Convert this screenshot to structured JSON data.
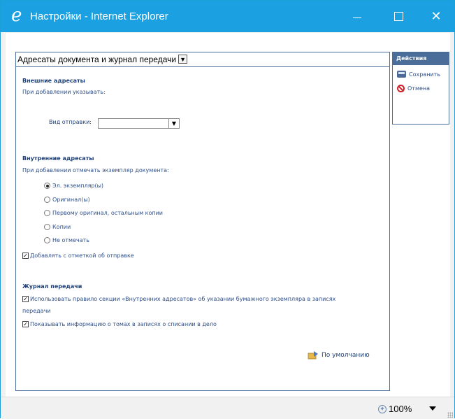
{
  "window": {
    "title": "Настройки - Internet Explorer",
    "accent": "#1ba1e2"
  },
  "panel": {
    "section_select": "Адресаты документа и журнал передачи",
    "external": {
      "heading": "Внешние адресаты",
      "hint": "При добавлении указывать:",
      "send_type_label": "Вид отправки:",
      "send_type_value": ""
    },
    "internal": {
      "heading": "Внутренние адресаты",
      "hint": "При добавлении отмечать экземпляр документа:",
      "options": [
        {
          "label": "Эл. экземпляр(ы)",
          "selected": true
        },
        {
          "label": "Оригинал(ы)",
          "selected": false
        },
        {
          "label": "Первому оригинал, остальным копии",
          "selected": false
        },
        {
          "label": "Копии",
          "selected": false
        },
        {
          "label": "Не отмечать",
          "selected": false
        }
      ],
      "add_with_mark": {
        "label": "Добавлять с отметкой об отправке",
        "checked": true
      }
    },
    "journal": {
      "heading": "Журнал передачи",
      "use_rule_line1": "Использовать правило секции «Внутренних адресатов» об указании бумажного экземпляра в записях",
      "use_rule_line2": "передачи",
      "use_rule_checked": true,
      "show_volumes": {
        "label": "Показывать информацию о томах в записях о списании в дело",
        "checked": true
      }
    },
    "default_link": "По умолчанию"
  },
  "actions": {
    "heading": "Действия",
    "save": "Сохранить",
    "cancel": "Отмена"
  },
  "statusbar": {
    "zoom": "100%"
  }
}
